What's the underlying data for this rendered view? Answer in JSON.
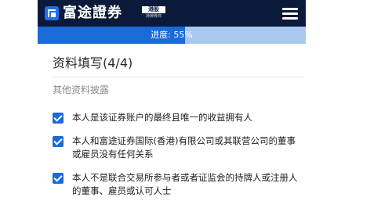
{
  "header": {
    "brand": "富途證券",
    "badge": "港股",
    "badge_sub": "持牌券商",
    "logo_icon": "futu-logo-icon",
    "menu_icon": "hamburger-menu-icon",
    "background": "#0b1a3a"
  },
  "progress": {
    "label": "进度: 55%",
    "value_percent": 55,
    "fill_color": "#1a6ad9",
    "track_color": "#a9c8ef"
  },
  "form": {
    "title": "资料填写(4/4)",
    "section_title": "其他资料披露",
    "items": [
      {
        "label": "本人是该证券账户的最终且唯一的收益拥有人",
        "checked": true
      },
      {
        "label": "本人和富途证券国际(香港)有限公司或其联营公司的董事或雇员没有任何关系",
        "checked": true
      },
      {
        "label": "本人不是联合交易所参与者或者证监会的持牌人或注册人的董事、雇员或认可人士",
        "checked": true
      }
    ],
    "checkbox_color": "#1a6ad9"
  }
}
